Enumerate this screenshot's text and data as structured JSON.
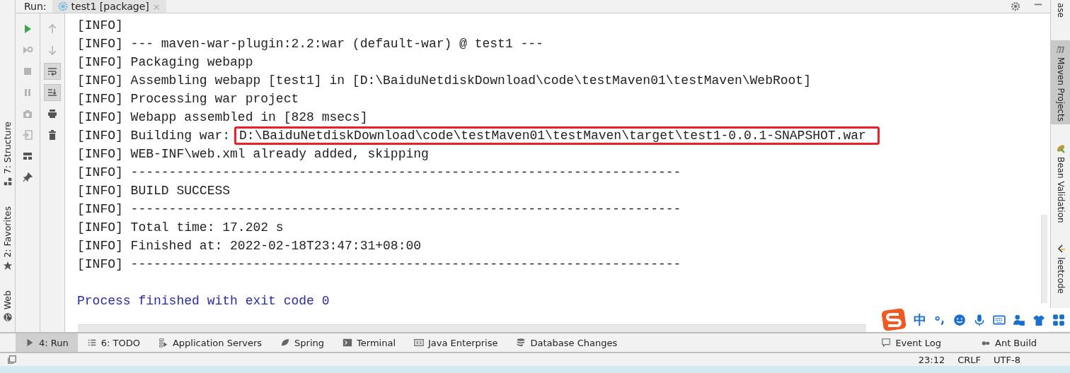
{
  "run_header": {
    "label": "Run:",
    "tabs": [
      {
        "title": "test1 [package]",
        "selected": true,
        "close": "×"
      }
    ]
  },
  "left_stripe": [
    {
      "label": "7: Structure"
    },
    {
      "label": "2: Favorites"
    },
    {
      "label": "Web"
    }
  ],
  "run_toolbar": [
    {
      "disabled": false
    },
    {
      "disabled": true
    },
    {
      "disabled": true
    },
    {
      "disabled": true
    },
    {
      "disabled": true
    },
    {
      "disabled": true
    },
    {
      "disabled": false
    },
    {
      "disabled": false
    }
  ],
  "console_toolbar": [
    {
      "on": false
    },
    {
      "on": false
    },
    {
      "on": true
    },
    {
      "on": true
    },
    {
      "on": false
    },
    {
      "on": false
    }
  ],
  "console": [
    {
      "kind": "info",
      "segments": [
        {
          "text": "[INFO]",
          "boxed": false
        }
      ]
    },
    {
      "kind": "info",
      "segments": [
        {
          "text": "[INFO] --- maven-war-plugin:2.2:war (default-war) @ test1 ---",
          "boxed": false
        }
      ]
    },
    {
      "kind": "info",
      "segments": [
        {
          "text": "[INFO] Packaging webapp",
          "boxed": false
        }
      ]
    },
    {
      "kind": "info",
      "segments": [
        {
          "text": "[INFO] Assembling webapp [test1] in [D:\\BaiduNetdiskDownload\\code\\testMaven01\\testMaven\\WebRoot]",
          "boxed": false
        }
      ]
    },
    {
      "kind": "info",
      "segments": [
        {
          "text": "[INFO] Processing war project",
          "boxed": false
        }
      ]
    },
    {
      "kind": "info",
      "segments": [
        {
          "text": "[INFO] Webapp assembled in [828 msecs]",
          "boxed": false
        }
      ]
    },
    {
      "kind": "info",
      "segments": [
        {
          "text": "[INFO] Building war:",
          "boxed": false
        },
        {
          "text": "D:\\BaiduNetdiskDownload\\code\\testMaven01\\testMaven\\target\\test1-0.0.1-SNAPSHOT.war",
          "boxed": true
        }
      ]
    },
    {
      "kind": "info",
      "segments": [
        {
          "text": "[INFO] WEB-INF\\web.xml already added, skipping",
          "boxed": false
        }
      ]
    },
    {
      "kind": "info",
      "segments": [
        {
          "text": "[INFO] ------------------------------------------------------------------------",
          "boxed": false
        }
      ]
    },
    {
      "kind": "info",
      "segments": [
        {
          "text": "[INFO] BUILD SUCCESS",
          "boxed": false
        }
      ]
    },
    {
      "kind": "info",
      "segments": [
        {
          "text": "[INFO] ------------------------------------------------------------------------",
          "boxed": false
        }
      ]
    },
    {
      "kind": "info",
      "segments": [
        {
          "text": "[INFO] Total time: 17.202 s",
          "boxed": false
        }
      ]
    },
    {
      "kind": "info",
      "segments": [
        {
          "text": "[INFO] Finished at: 2022-02-18T23:47:31+08:00",
          "boxed": false
        }
      ]
    },
    {
      "kind": "info",
      "segments": [
        {
          "text": "[INFO] ------------------------------------------------------------------------",
          "boxed": false
        }
      ]
    },
    {
      "kind": "blank"
    },
    {
      "kind": "system",
      "segments": [
        {
          "text": "Process finished with exit code 0",
          "boxed": false
        }
      ]
    }
  ],
  "right_stripe": [
    {
      "label": "ase",
      "selected": false
    },
    {
      "label": "Maven Projects",
      "selected": true
    },
    {
      "label": "Bean Validation",
      "selected": false
    },
    {
      "label": "leetcode",
      "selected": false
    }
  ],
  "bottom_tools": [
    {
      "label": "4: Run",
      "selected": true
    },
    {
      "label": "6: TODO",
      "selected": false
    },
    {
      "label": "Application Servers",
      "selected": false
    },
    {
      "label": "Spring",
      "selected": false
    },
    {
      "label": "Terminal",
      "selected": false
    },
    {
      "label": "Java Enterprise",
      "selected": false
    },
    {
      "label": "Database Changes",
      "selected": false
    }
  ],
  "bottom_tools_right": [
    {
      "label": "Event Log"
    },
    {
      "label": "Ant Build"
    }
  ],
  "ime_bar": {
    "mode": "中"
  },
  "status_bar": {
    "items": [
      "23:12",
      "CRLF",
      "UTF-8"
    ]
  }
}
